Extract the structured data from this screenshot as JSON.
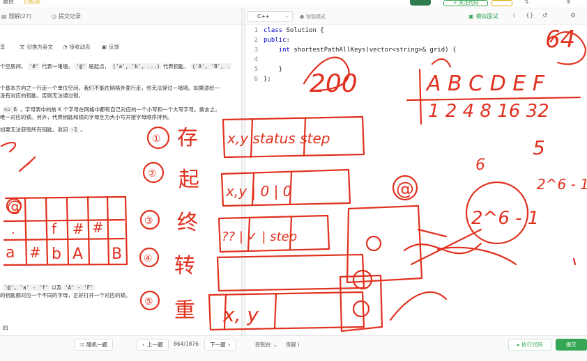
{
  "topbar": {
    "tab1": "题目",
    "tab2": "已标签",
    "pill": "+ 关注代码",
    "misc1": "⇅",
    "misc2": "⊕"
  },
  "left_tabs": [
    {
      "icon": "document-icon",
      "glyph": "▤",
      "label": "题解(27)"
    },
    {
      "icon": "clock-icon",
      "glyph": "◷",
      "label": "提交记录"
    }
  ],
  "sub_tabs": [
    {
      "icon": "share-icon",
      "glyph": "",
      "label": "享"
    },
    {
      "icon": "translate-icon",
      "glyph": "文",
      "label": "切换为英文"
    },
    {
      "icon": "bell-icon",
      "glyph": "◔",
      "label": "接收动态"
    },
    {
      "icon": "feedback-icon",
      "glyph": "▣",
      "label": "反馈"
    }
  ],
  "description": {
    "line1a": "个空房间，",
    "line1_code1": "'#'",
    "line1b": "代表一堵墙，",
    "line1_code2": "'@'",
    "line1c": "是起点，",
    "line1_code3": "('a', 'b', ...)",
    "line1d": "代表钥匙，",
    "line1_code4": "('A', 'B', .",
    "line2": "个基本方向之一行走一个单位空间。我们不能在网格外面行走，也无法穿过一堵墙。如果途经一",
    "line3": "没有对应的钥匙，否则无法通过锁。",
    "line4a": "<= 6",
    "line4b": "，字母表中的前 K 个字母在网格中都有自己对应的一个小写和一个大写字母。换言之，",
    "line5": "唯一对应的锁。另外，代表钥匙和锁的字母互为大小写并按字母顺序排列。",
    "line6a": "如果无法获取所有钥匙，返回",
    "line6_code": "-1",
    "line6b": "。",
    "line7a": "'@', 'a' - 'f'",
    "line7b": "以及",
    "line7_code": "'A' - 'F'",
    "line8": "的钥匙都对应一个不同的字母，正好打开一个对应的锁。",
    "line9": "四"
  },
  "editor": {
    "language": "C++",
    "smart_mode": "智能模式",
    "mock_interview": "模拟面试",
    "icons": [
      "info-icon",
      "braces-icon",
      "reset-icon",
      "settings-icon"
    ],
    "icon_glyphs": [
      "i",
      "{}",
      "↺",
      "⚙"
    ]
  },
  "code_lines": [
    {
      "num": "1",
      "parts": [
        {
          "t": "class ",
          "c": "kw"
        },
        {
          "t": "Solution {",
          "c": "tx"
        }
      ]
    },
    {
      "num": "2",
      "parts": [
        {
          "t": "public",
          "c": "kw"
        },
        {
          "t": ":",
          "c": "tx"
        }
      ]
    },
    {
      "num": "3",
      "parts": [
        {
          "t": "    ",
          "c": "tx"
        },
        {
          "t": "int ",
          "c": "ty"
        },
        {
          "t": "shortestPathAllKeys(vector<string>& grid) {",
          "c": "tx"
        }
      ]
    },
    {
      "num": "4",
      "parts": [
        {
          "t": "",
          "c": "tx"
        }
      ]
    },
    {
      "num": "5",
      "parts": [
        {
          "t": "    }",
          "c": "tx"
        }
      ]
    },
    {
      "num": "6",
      "parts": [
        {
          "t": "};",
          "c": "tx"
        }
      ]
    }
  ],
  "bottom": {
    "random": "随机一题",
    "prev": "上一题",
    "counter": "864/1876",
    "next": "下一题",
    "console": "控制台",
    "contribute": "贡献 i",
    "run": "执行代码",
    "submit": "提交"
  },
  "colors": {
    "accent_green": "#35a654",
    "annotation_red": "#e0301e",
    "keyword_blue": "#0000cc"
  },
  "handwriting": {
    "steps": [
      "①",
      "②",
      "③",
      "④",
      "⑤"
    ],
    "step_words": [
      "存",
      "起",
      "终",
      "转",
      "重"
    ],
    "box1_text": "x,y status step",
    "box2_text": "x,y | 0 | 0",
    "box3_text": "?? | ✓ | step",
    "box5_text": "x, y",
    "number_top": "200",
    "number_right": "64",
    "letters": "A B C D E F",
    "powers": "1 2 4 8 16 32",
    "six": "6",
    "five": "5",
    "two_pow_6_minus_1": "2^6 - 1",
    "at": "@",
    "grid_cells": [
      "@",
      ".",
      "#",
      "#",
      "a",
      "#",
      "b",
      "A",
      "B",
      "f"
    ]
  }
}
